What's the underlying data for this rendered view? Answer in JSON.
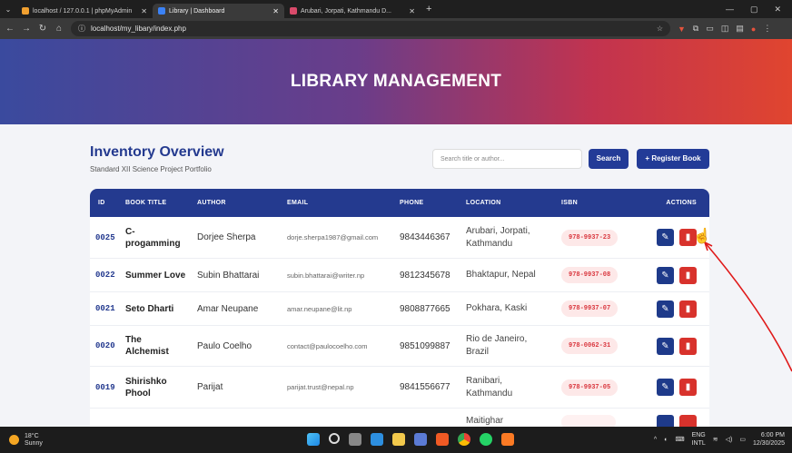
{
  "browser": {
    "tabs": [
      {
        "label": "localhost / 127.0.0.1 | phpMyAdmin",
        "color": "#f0a030",
        "active": false
      },
      {
        "label": "Library | Dashboard",
        "color": "#3b82f6",
        "active": true
      },
      {
        "label": "Arubari, Jorpati, Kathmandu D...",
        "color": "#d94a6a",
        "active": false
      }
    ],
    "url": "localhost/my_libary/index.php"
  },
  "hero": {
    "title": "LIBRARY MANAGEMENT"
  },
  "inventory": {
    "title": "Inventory Overview",
    "subtitle": "Standard XII Science Project Portfolio",
    "search_placeholder": "Search title or author...",
    "search_label": "Search",
    "register_label": "+ Register Book"
  },
  "table": {
    "headers": [
      "ID",
      "BOOK TITLE",
      "AUTHOR",
      "EMAIL",
      "PHONE",
      "LOCATION",
      "ISBN",
      "ACTIONS"
    ],
    "rows": [
      {
        "id": "0025",
        "title": "C-progamming",
        "author": "Dorjee Sherpa",
        "email": "dorje.sherpa1987@gmail.com",
        "phone": "9843446367",
        "location": "Arubari, Jorpati, Kathmandu",
        "isbn": "978-9937-23"
      },
      {
        "id": "0022",
        "title": "Summer Love",
        "author": "Subin Bhattarai",
        "email": "subin.bhattarai@writer.np",
        "phone": "9812345678",
        "location": "Bhaktapur, Nepal",
        "isbn": "978-9937-08"
      },
      {
        "id": "0021",
        "title": "Seto Dharti",
        "author": "Amar Neupane",
        "email": "amar.neupane@lit.np",
        "phone": "9808877665",
        "location": "Pokhara, Kaski",
        "isbn": "978-9937-07"
      },
      {
        "id": "0020",
        "title": "The Alchemist",
        "author": "Paulo Coelho",
        "email": "contact@paulocoelho.com",
        "phone": "9851099887",
        "location": "Rio de Janeiro, Brazil",
        "isbn": "978-0062-31"
      },
      {
        "id": "0019",
        "title": "Shirishko Phool",
        "author": "Parijat",
        "email": "parijat.trust@nepal.np",
        "phone": "9841556677",
        "location": "Ranibari, Kathmandu",
        "isbn": "978-9937-05"
      },
      {
        "id": "",
        "title": "",
        "author": "",
        "email": "",
        "phone": "",
        "location": "Maitighar",
        "isbn": ""
      }
    ]
  },
  "taskbar": {
    "temp": "18°C",
    "condition": "Sunny",
    "lang1": "ENG",
    "lang2": "INTL",
    "time": "6:00 PM",
    "date": "12/30/2025"
  }
}
